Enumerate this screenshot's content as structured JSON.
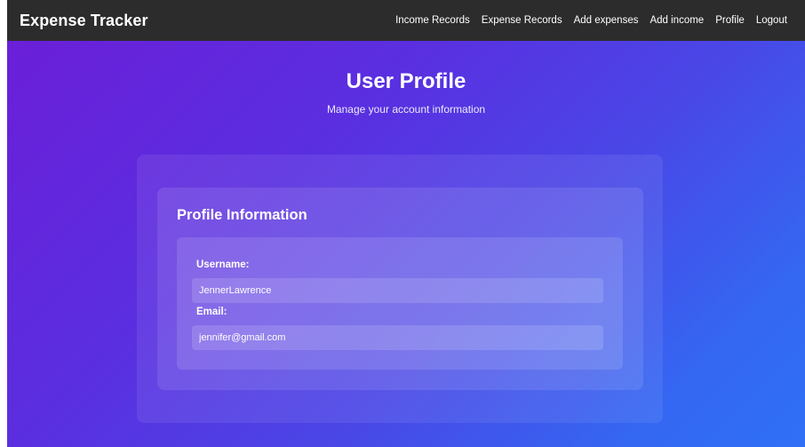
{
  "navbar": {
    "brand": "Expense Tracker",
    "links": [
      {
        "label": "Income Records"
      },
      {
        "label": "Expense Records"
      },
      {
        "label": "Add expenses"
      },
      {
        "label": "Add income"
      },
      {
        "label": "Profile"
      },
      {
        "label": "Logout"
      }
    ]
  },
  "page": {
    "title": "User Profile",
    "subtitle": "Manage your account information"
  },
  "profile": {
    "section_title": "Profile Information",
    "username_label": "Username:",
    "username_value": "JennerLawrence",
    "email_label": "Email:",
    "email_value": "jennifer@gmail.com"
  },
  "colors": {
    "navbar_bg": "#2c2c2c",
    "gradient_start": "#6a1fd8",
    "gradient_end": "#2f70f6"
  }
}
